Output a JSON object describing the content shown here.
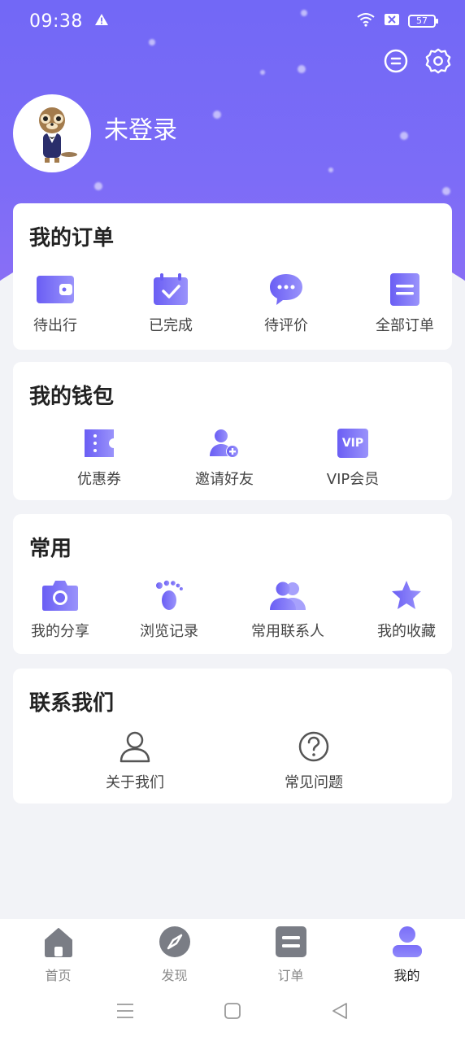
{
  "status": {
    "time": "09:38",
    "battery": "57"
  },
  "profile": {
    "name": "未登录"
  },
  "orders": {
    "title": "我的订单",
    "items": [
      {
        "label": "待出行",
        "icon": "wallet-icon"
      },
      {
        "label": "已完成",
        "icon": "calendar-check-icon"
      },
      {
        "label": "待评价",
        "icon": "chat-bubble-icon"
      },
      {
        "label": "全部订单",
        "icon": "list-doc-icon"
      }
    ]
  },
  "wallet": {
    "title": "我的钱包",
    "items": [
      {
        "label": "优惠券",
        "icon": "ticket-icon"
      },
      {
        "label": "邀请好友",
        "icon": "add-user-icon"
      },
      {
        "label": "VIP会员",
        "icon": "vip-icon",
        "badge": "VIP"
      }
    ]
  },
  "common": {
    "title": "常用",
    "items": [
      {
        "label": "我的分享",
        "icon": "camera-icon"
      },
      {
        "label": "浏览记录",
        "icon": "footprint-icon"
      },
      {
        "label": "常用联系人",
        "icon": "contacts-icon"
      },
      {
        "label": "我的收藏",
        "icon": "star-icon"
      }
    ]
  },
  "contact": {
    "title": "联系我们",
    "items": [
      {
        "label": "关于我们",
        "icon": "person-outline-icon"
      },
      {
        "label": "常见问题",
        "icon": "question-circle-icon"
      }
    ]
  },
  "tabbar": {
    "items": [
      {
        "label": "首页",
        "icon": "home-icon"
      },
      {
        "label": "发现",
        "icon": "compass-icon"
      },
      {
        "label": "订单",
        "icon": "order-doc-icon"
      },
      {
        "label": "我的",
        "icon": "profile-icon"
      }
    ],
    "active_index": 3
  },
  "colors": {
    "accent": "#7268f6",
    "accent_light": "#8a83fb",
    "icon_gray": "#7a7d85"
  }
}
